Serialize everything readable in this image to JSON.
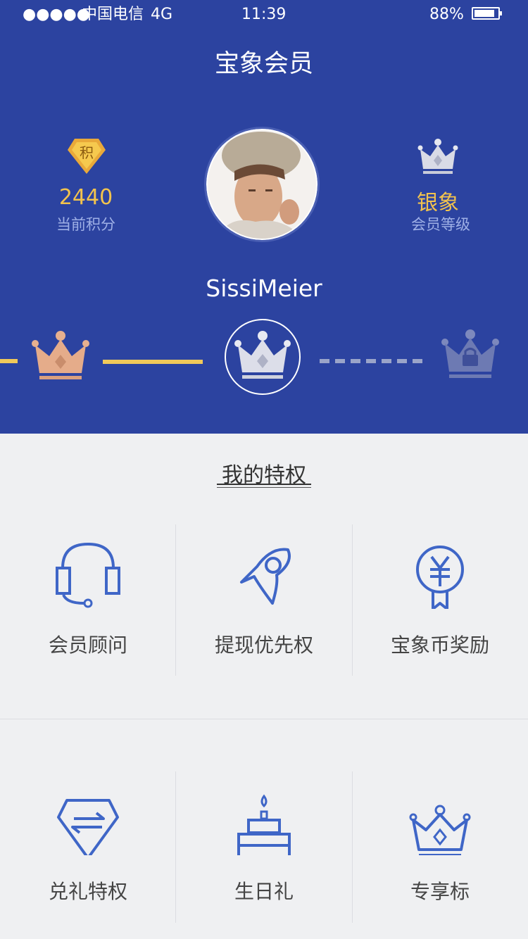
{
  "status_bar": {
    "signal": "●●●●●",
    "carrier": "中国电信",
    "network": "4G",
    "time": "11:39",
    "battery_percent": "88%",
    "battery_level": 0.88
  },
  "header": {
    "title": "宝象会员",
    "points": {
      "badge_char": "积",
      "value": "2440",
      "label": "当前积分"
    },
    "level": {
      "value": "银象",
      "label": "会员等级"
    },
    "username": "SissiMeier"
  },
  "level_track": {
    "levels": [
      "bronze",
      "silver",
      "locked"
    ],
    "current_index": 1
  },
  "privileges": {
    "title": "我的特权",
    "items": [
      {
        "label": "会员顾问",
        "icon": "headset-icon"
      },
      {
        "label": "提现优先权",
        "icon": "rocket-icon"
      },
      {
        "label": "宝象币奖励",
        "icon": "yuan-coin-ribbon-icon"
      },
      {
        "label": "兑礼特权",
        "icon": "exchange-gem-icon"
      },
      {
        "label": "生日礼",
        "icon": "birthday-cake-icon"
      },
      {
        "label": "专享标",
        "icon": "crown-icon"
      }
    ]
  },
  "colors": {
    "header_bg": "#2c43a0",
    "accent_gold": "#f2c34d",
    "icon_blue": "#3f66c7",
    "page_bg": "#eff0f2"
  }
}
